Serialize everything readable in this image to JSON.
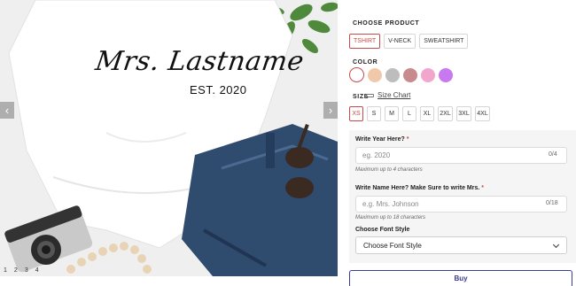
{
  "gallery": {
    "shirt_text": "Mrs. Lastname",
    "shirt_est": "EST. 2020",
    "prev_icon": "‹",
    "next_icon": "›",
    "dots": [
      "1",
      "2",
      "3",
      "4"
    ]
  },
  "product": {
    "label": "CHOOSE PRODUCT",
    "options": [
      "TSHIRT",
      "V-NECK",
      "SWEATSHIRT"
    ],
    "selected": "TSHIRT"
  },
  "color": {
    "label": "COLOR",
    "swatches": [
      "#ffffff",
      "#f1c8a9",
      "#bdbdbd",
      "#c98a8e",
      "#f3a6cb",
      "#c879f0"
    ],
    "selected_index": 0
  },
  "size": {
    "label": "SIZE",
    "chart_label": "Size Chart",
    "options": [
      "XS",
      "S",
      "M",
      "L",
      "XL",
      "2XL",
      "3XL",
      "4XL"
    ],
    "selected": "XS"
  },
  "personalize": {
    "year": {
      "label": "Write Year Here?",
      "required_mark": "*",
      "placeholder": "eg. 2020",
      "counter": "0/4",
      "hint": "Maximum up to 4 characters"
    },
    "name": {
      "label": "Write Name Here? Make Sure to write Mrs.",
      "required_mark": "*",
      "placeholder": "e.g. Mrs. Johnson",
      "counter": "0/18",
      "hint": "Maximum up to 18 characters"
    },
    "font": {
      "label": "Choose Font Style",
      "value": "Choose Font Style"
    }
  },
  "cart": {
    "label": "Buy"
  },
  "colors": {
    "accent": "#c84a4a",
    "button_border": "#3b3b8f"
  }
}
